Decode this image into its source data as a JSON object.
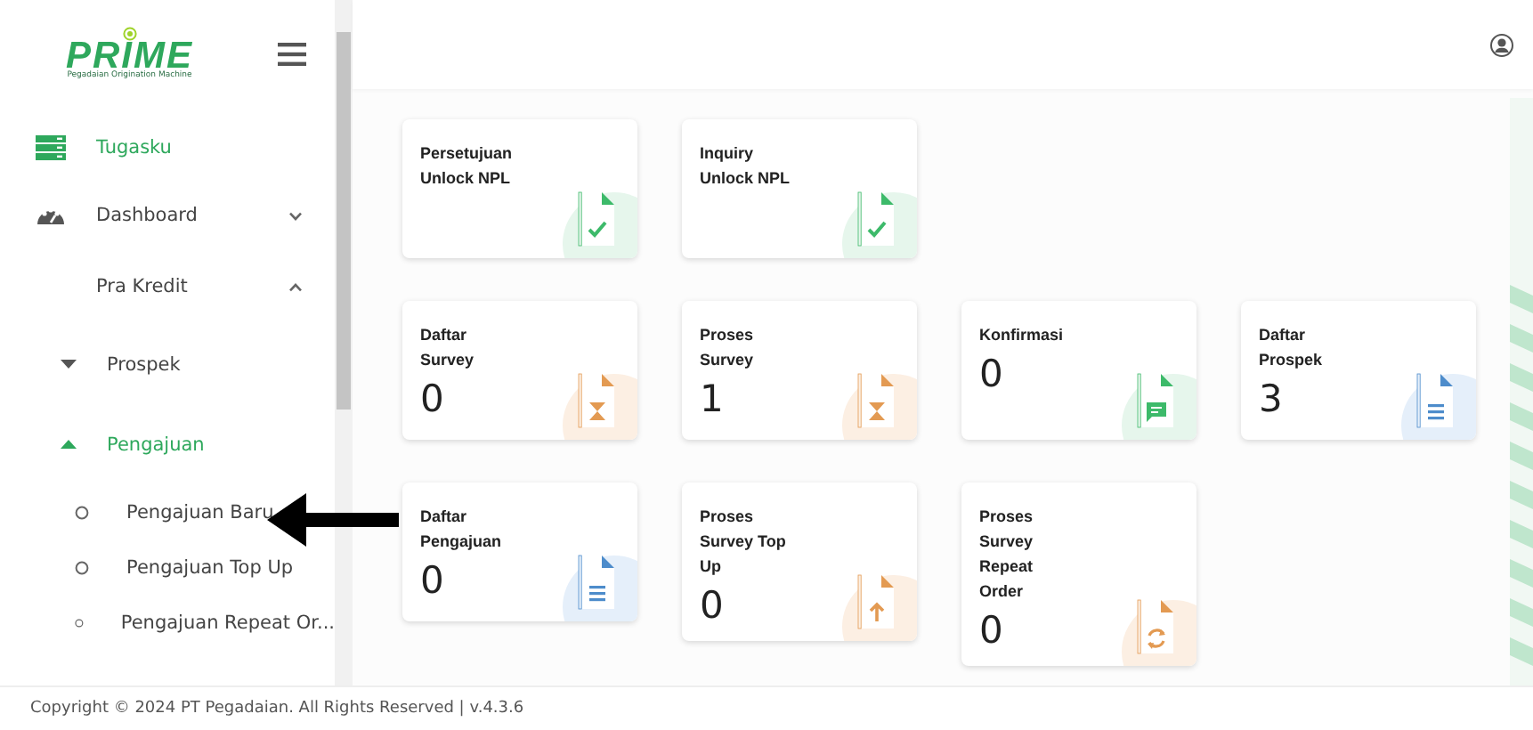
{
  "sidebar": {
    "logo": {
      "wordmark": "PRIME",
      "tagline": "Pegadaian Origination Machine"
    },
    "menu": [
      {
        "label": "Tugasku",
        "kind": "icon",
        "selected": true
      },
      {
        "label": "Dashboard",
        "kind": "icon",
        "selected": false,
        "expanded": false
      },
      {
        "label": "Pra Kredit",
        "kind": "group",
        "selected": false,
        "expanded": true,
        "children": [
          {
            "label": "Prospek",
            "selected": false,
            "expanded": false
          },
          {
            "label": "Pengajuan",
            "selected": true,
            "expanded": true,
            "children": [
              {
                "label": "Pengajuan Baru",
                "selected": false
              },
              {
                "label": "Pengajuan Top Up",
                "selected": false
              },
              {
                "label": "Pengajuan Repeat Or...",
                "selected": false
              }
            ]
          }
        ]
      }
    ]
  },
  "cards": [
    [
      {
        "title_lines": [
          "Persetujuan",
          "Unlock NPL"
        ]
      },
      {
        "title_lines": [
          "Inquiry",
          "Unlock NPL"
        ]
      }
    ],
    [
      {
        "title_lines": [
          "Daftar",
          "Survey"
        ],
        "count": "0"
      },
      {
        "title_lines": [
          "Proses",
          "Survey"
        ],
        "count": "1"
      },
      {
        "title_lines": [
          "Konfirmasi"
        ],
        "count": "0"
      },
      {
        "title_lines": [
          "Daftar",
          "Prospek"
        ],
        "count": "3"
      }
    ],
    [
      {
        "title_lines": [
          "Daftar",
          "Pengajuan"
        ],
        "count": "0"
      },
      {
        "title_lines": [
          "Proses",
          "Survey Top",
          "Up"
        ],
        "count": "0"
      },
      {
        "title_lines": [
          "Proses",
          "Survey",
          "Repeat",
          "Order"
        ],
        "count": "0"
      }
    ]
  ],
  "footer": "Copyright © 2024 PT Pegadaian. All Rights Reserved | v.4.3.6"
}
